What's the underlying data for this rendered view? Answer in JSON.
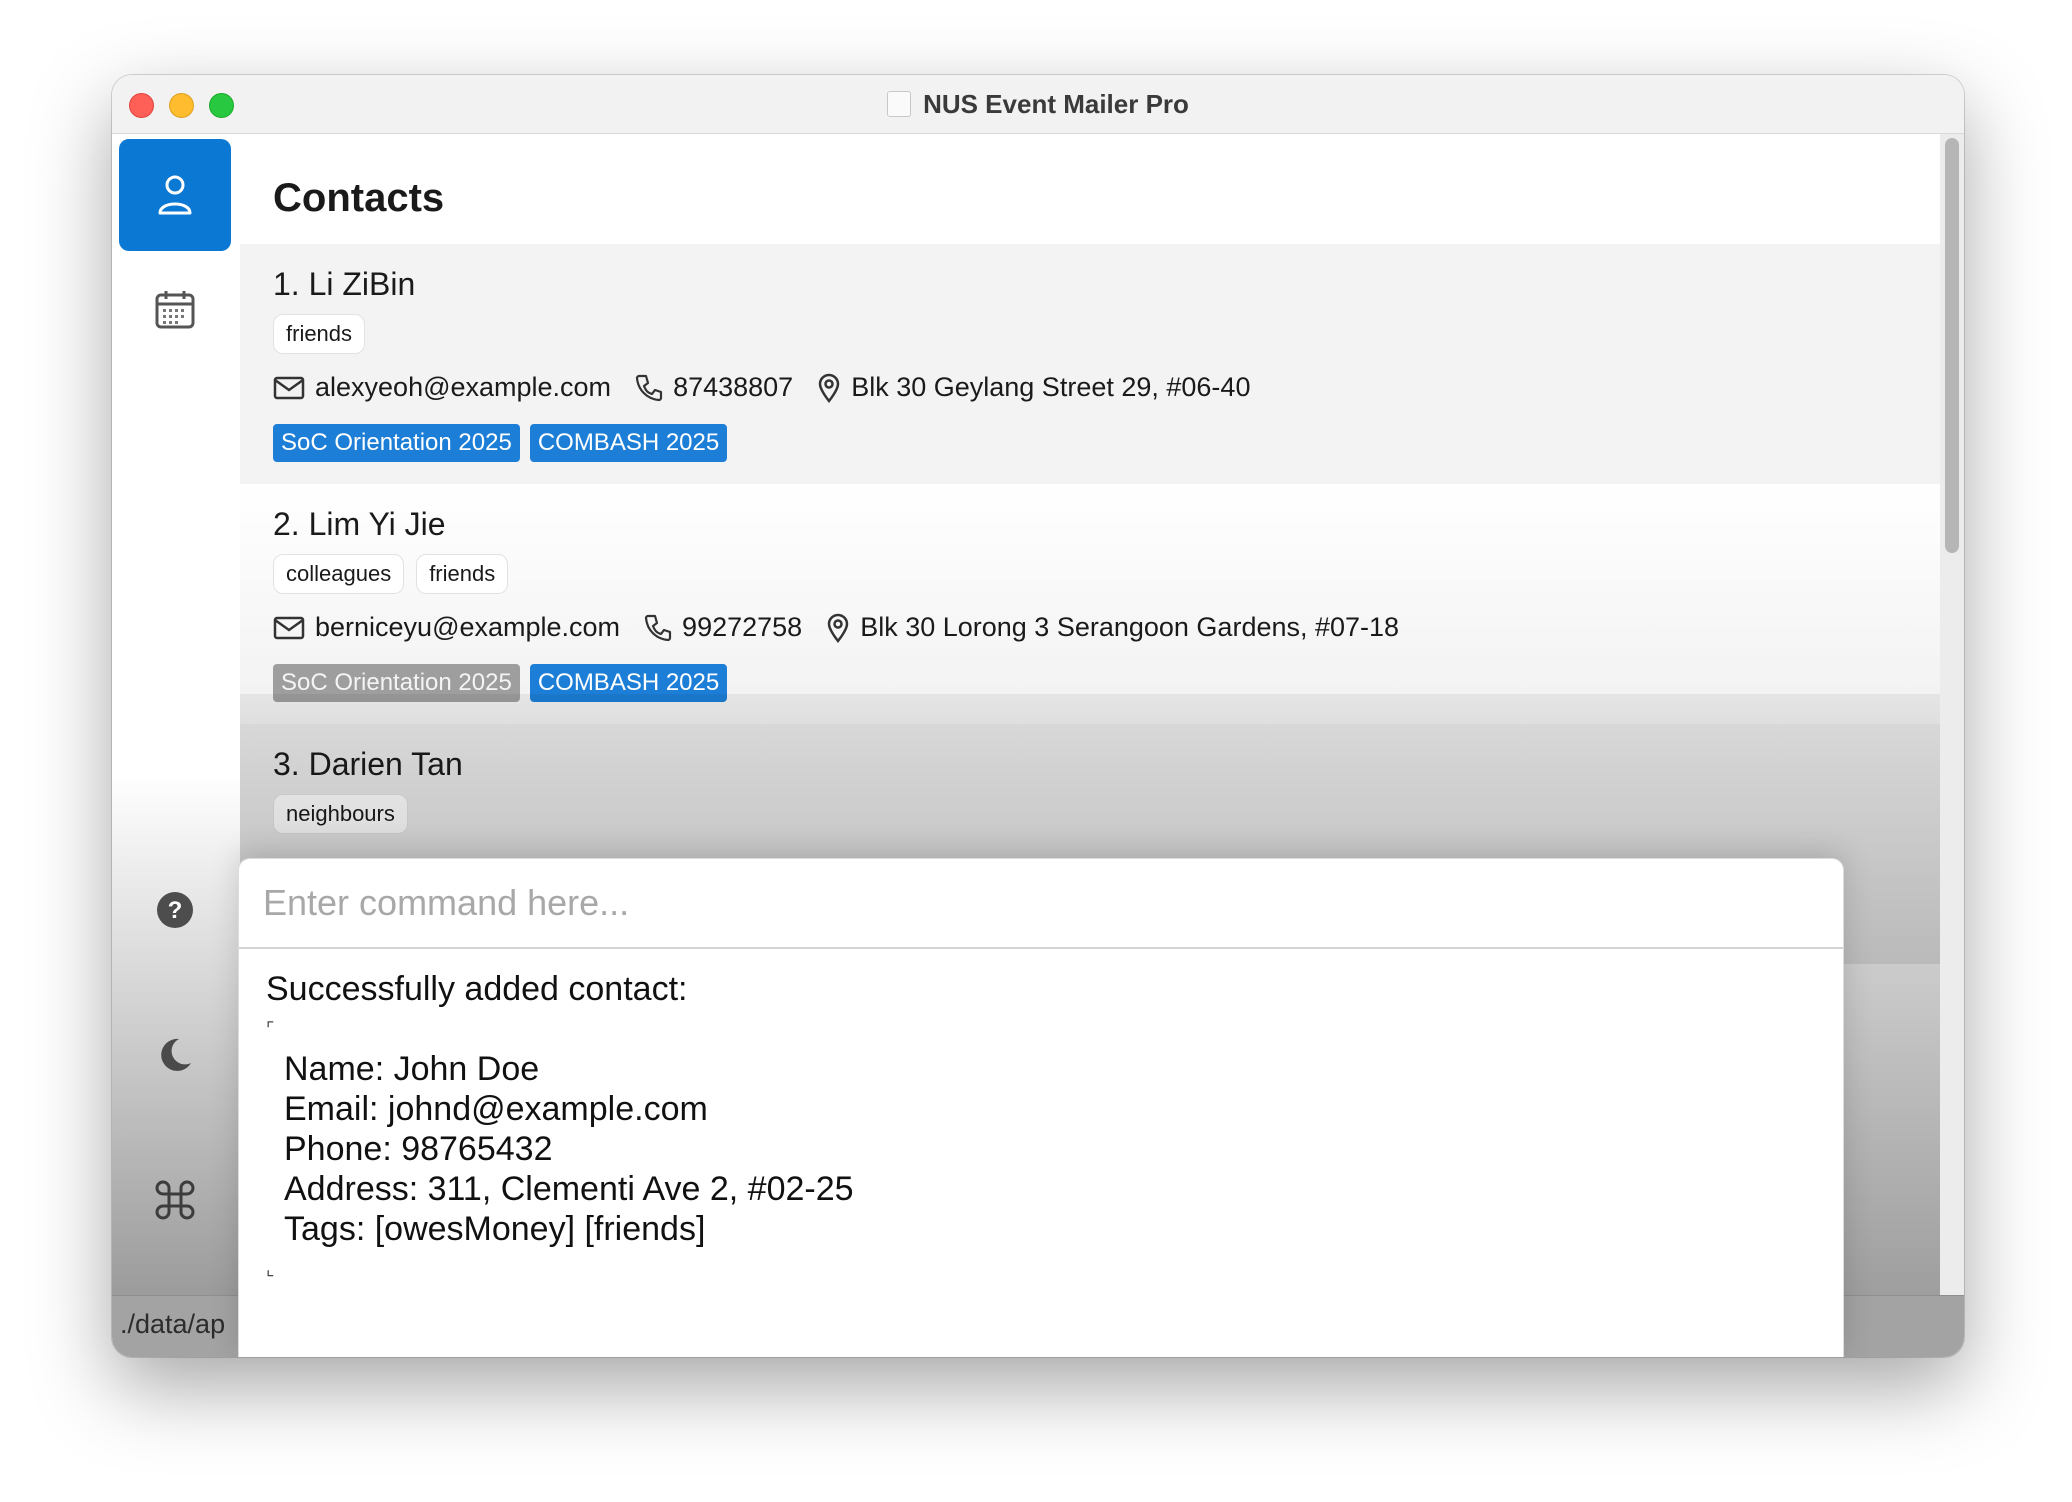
{
  "window": {
    "title": "NUS Event Mailer Pro"
  },
  "sidebar": {
    "items": [
      {
        "name": "contacts",
        "icon": "person-icon",
        "active": true
      },
      {
        "name": "events",
        "icon": "calendar-icon",
        "active": false
      },
      {
        "name": "help",
        "icon": "help-icon",
        "active": false
      },
      {
        "name": "theme",
        "icon": "moon-icon",
        "active": false
      },
      {
        "name": "commands",
        "icon": "command-icon",
        "active": false
      }
    ]
  },
  "main": {
    "title": "Contacts",
    "contacts": [
      {
        "name": "1. Li ZiBin",
        "tags": [
          "friends"
        ],
        "email": "alexyeoh@example.com",
        "phone": "87438807",
        "address": "Blk 30 Geylang Street 29, #06-40",
        "events": [
          {
            "label": "SoC Orientation 2025",
            "past": false
          },
          {
            "label": "COMBASH 2025",
            "past": false
          }
        ]
      },
      {
        "name": "2. Lim Yi Jie",
        "tags": [
          "colleagues",
          "friends"
        ],
        "email": "berniceyu@example.com",
        "phone": "99272758",
        "address": "Blk 30 Lorong 3 Serangoon Gardens, #07-18",
        "events": [
          {
            "label": "SoC Orientation 2025",
            "past": true
          },
          {
            "label": "COMBASH 2025",
            "past": false
          }
        ]
      },
      {
        "name": "3. Darien Tan",
        "tags": [
          "neighbours"
        ]
      }
    ]
  },
  "command": {
    "placeholder": "Enter command here...",
    "value": ""
  },
  "result": {
    "heading": "Successfully added contact:",
    "open_mark": "⌜",
    "lines": [
      "Name: John Doe",
      "Email: johnd@example.com",
      "Phone: 98765432",
      "Address: 311, Clementi Ave 2, #02-25",
      "Tags: [owesMoney] [friends]"
    ],
    "close_mark": "⌞"
  },
  "status": {
    "path": "./data/ap"
  },
  "colors": {
    "accent": "#0b78d4",
    "event_active": "#1c7ed6",
    "event_past": "#9e9e9e"
  }
}
